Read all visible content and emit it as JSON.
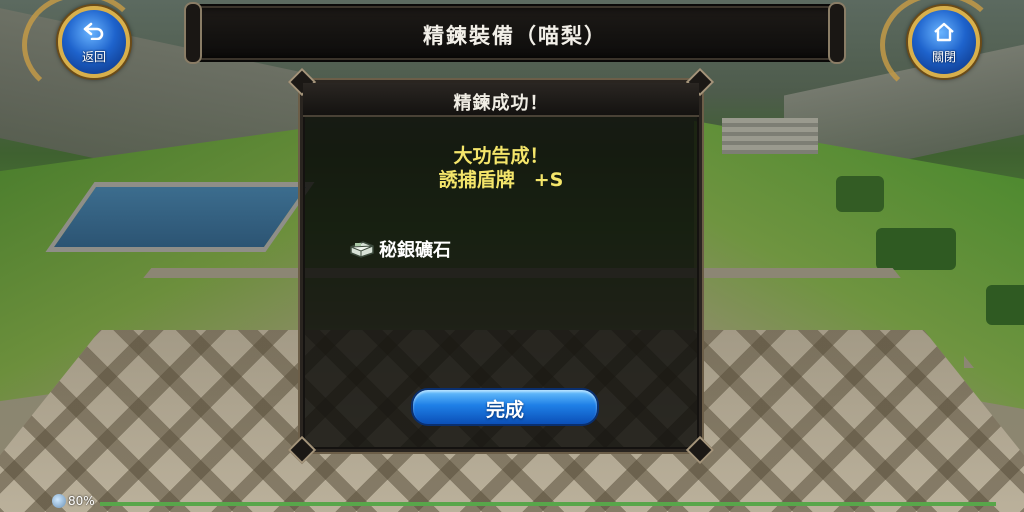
{
  "header": {
    "title": "精鍊裝備（喵梨）",
    "back_button": {
      "icon": "back-arrow-icon",
      "label": "返回"
    },
    "close_button": {
      "icon": "home-icon",
      "label": "關閉"
    }
  },
  "dialog": {
    "title": "精鍊成功！",
    "message_line1": "大功告成！",
    "message_line2": "誘捕盾牌　+S",
    "item": {
      "icon": "ore-icon",
      "name": "秘銀礦石"
    },
    "confirm_label": "完成"
  },
  "status": {
    "battery_icon": "battery-icon",
    "battery_text": "80%",
    "progress": 1.0
  },
  "colors": {
    "accent_blue": "#1e7fe6",
    "message_yellow": "#f4e56a",
    "frame_gold": "#d8b04c"
  }
}
